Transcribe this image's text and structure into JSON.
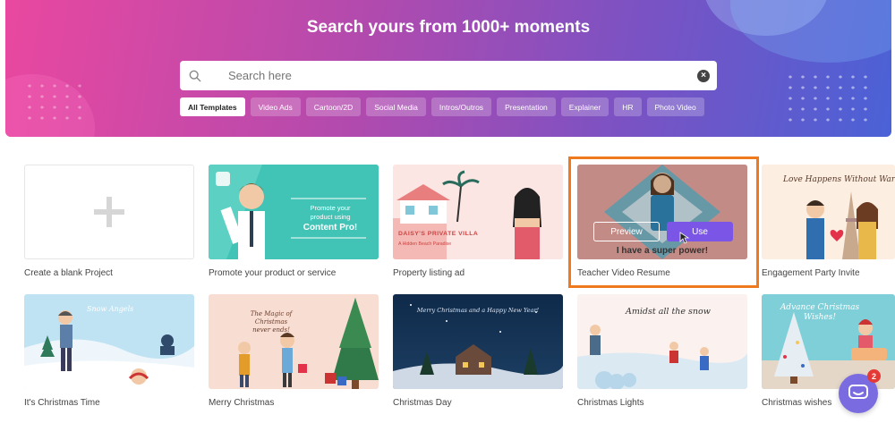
{
  "hero": {
    "title": "Search yours from 1000+ moments",
    "search_placeholder": "Search here",
    "clear_glyph": "×"
  },
  "filters": [
    {
      "label": "All Templates",
      "active": true
    },
    {
      "label": "Video Ads",
      "active": false
    },
    {
      "label": "Cartoon/2D",
      "active": false
    },
    {
      "label": "Social Media",
      "active": false
    },
    {
      "label": "Intros/Outros",
      "active": false
    },
    {
      "label": "Presentation",
      "active": false
    },
    {
      "label": "Explainer",
      "active": false
    },
    {
      "label": "HR",
      "active": false
    },
    {
      "label": "Photo Video",
      "active": false
    }
  ],
  "templates": {
    "blank": {
      "title": "Create a blank Project"
    },
    "promote": {
      "title": "Promote your product or service",
      "thumb_text_1": "Promote your",
      "thumb_text_2": "product using",
      "thumb_text_3": "Content Pro!"
    },
    "property": {
      "title": "Property listing ad",
      "thumb_text_1": "DAISY'S PRIVATE VILLA",
      "thumb_text_2": "A Hidden Beach Paradise"
    },
    "teacher": {
      "title": "Teacher Video Resume",
      "thumb_caption": "I have a super power!",
      "preview_label": "Preview",
      "use_label": "Use"
    },
    "engagement": {
      "title": "Engagement Party Invite",
      "thumb_text": "Love Happens Without War"
    },
    "xmas_time": {
      "title": "It's Christmas Time",
      "thumb_text": "Snow Angels"
    },
    "merry": {
      "title": "Merry Christmas",
      "thumb_text_1": "The Magic of Christmas",
      "thumb_text_2": "never ends!"
    },
    "xmas_day": {
      "title": "Christmas Day",
      "thumb_text": "Merry Christmas and a Happy New Year!"
    },
    "lights": {
      "title": "Christmas Lights",
      "thumb_text": "Amidst all the snow"
    },
    "wishes": {
      "title": "Christmas wishes",
      "thumb_text_1": "Advance Christmas",
      "thumb_text_2": "Wishes!"
    }
  },
  "chat": {
    "badge": "2"
  },
  "colors": {
    "accent": "#7b55e6",
    "highlight": "#ef7a1e"
  }
}
